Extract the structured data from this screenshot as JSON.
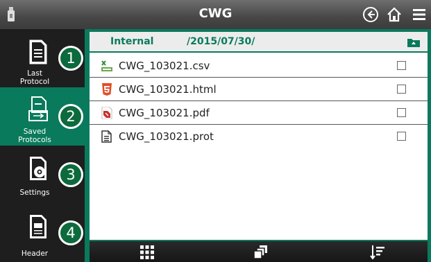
{
  "header": {
    "title": "CWG",
    "icons": [
      "usb-drive-icon",
      "back-icon",
      "home-icon",
      "menu-icon"
    ]
  },
  "sidebar": {
    "items": [
      {
        "label": "Last\nProtocol",
        "icon": "document-icon",
        "badge": "1",
        "active": false
      },
      {
        "label": "Saved\nProtocols",
        "icon": "saved-protocols-icon",
        "badge": "2",
        "active": true
      },
      {
        "label": "Settings",
        "icon": "settings-document-icon",
        "badge": "3",
        "active": false
      },
      {
        "label": "Header",
        "icon": "header-document-icon",
        "badge": "4",
        "active": false
      }
    ]
  },
  "path": {
    "location": "Internal",
    "folder": "/2015/07/30/"
  },
  "files": [
    {
      "name": "CWG_103021.csv",
      "icon": "csv-file-icon",
      "checked": false
    },
    {
      "name": "CWG_103021.html",
      "icon": "html-file-icon",
      "checked": false
    },
    {
      "name": "CWG_103021.pdf",
      "icon": "pdf-file-icon",
      "checked": false
    },
    {
      "name": "CWG_103021.prot",
      "icon": "protocol-file-icon",
      "checked": false
    }
  ],
  "toolbar": {
    "icons": [
      "grid-view-icon",
      "copy-icon",
      "sort-icon"
    ]
  },
  "colors": {
    "accent": "#0a7a5c",
    "badge": "#0c6a3c",
    "sidebar_bg": "#1e1e1e",
    "header_bg": "#474747"
  }
}
